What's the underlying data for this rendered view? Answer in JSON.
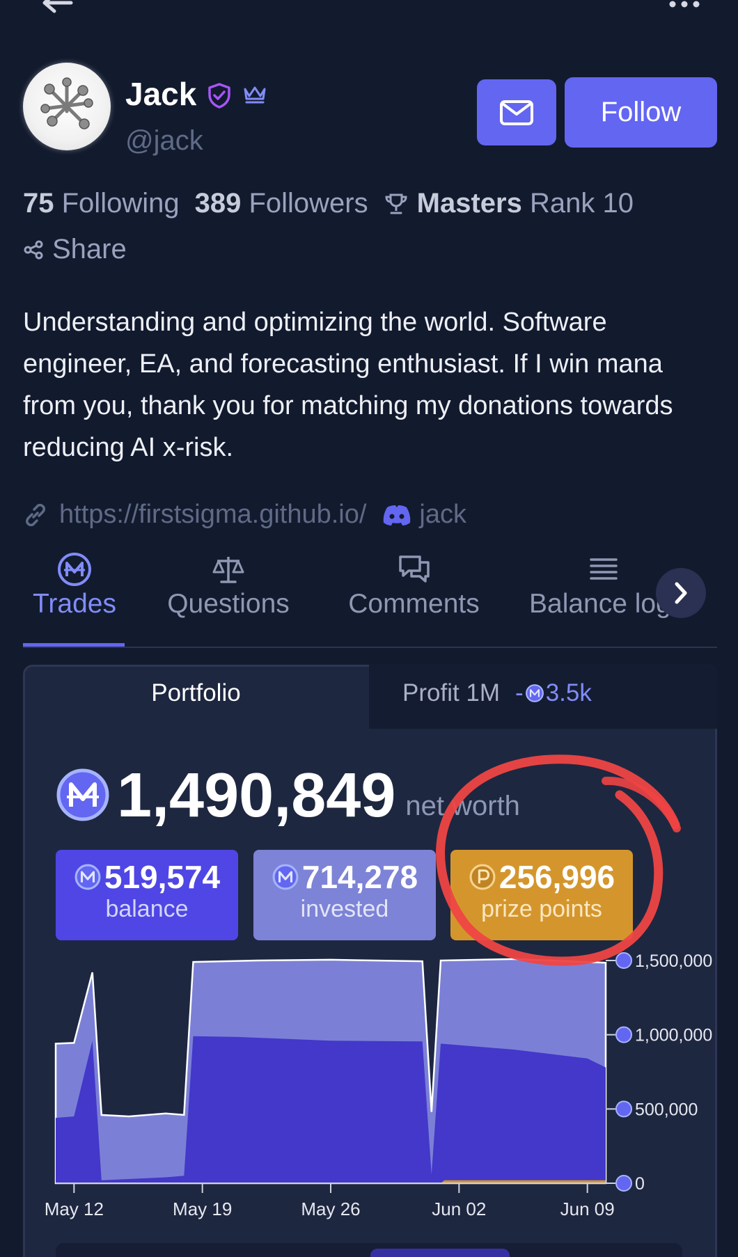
{
  "profile": {
    "name": "Jack",
    "handle": "@jack",
    "following_count": "75",
    "following_label": "Following",
    "followers_count": "389",
    "followers_label": "Followers",
    "league": "Masters",
    "rank": "Rank 10",
    "share_label": "Share",
    "bio": "Understanding and optimizing the world. Software engineer, EA, and forecasting enthusiast. If I win mana from you, thank you for matching my donations towards reducing AI x-risk.",
    "website": "https://firstsigma.github.io/",
    "discord": "jack",
    "follow_label": "Follow"
  },
  "tabs": [
    {
      "label": "Trades",
      "icon": "mana-icon",
      "active": true
    },
    {
      "label": "Questions",
      "icon": "scale-icon"
    },
    {
      "label": "Comments",
      "icon": "chat-icon"
    },
    {
      "label": "Balance log",
      "icon": "list-icon"
    }
  ],
  "portfolio": {
    "tab_portfolio": "Portfolio",
    "tab_profit": "Profit 1M",
    "profit_value": "3.5k",
    "profit_sign": "-",
    "net_worth": "1,490,849",
    "net_worth_label": "net worth",
    "balance": "519,574",
    "balance_label": "balance",
    "invested": "714,278",
    "invested_label": "invested",
    "prize_points": "256,996",
    "prize_points_label": "prize points"
  },
  "colors": {
    "accent": "#6366f1",
    "balance": "#4f46e5",
    "invested": "#7d83d6",
    "prize": "#d4962c",
    "annotation": "#ef4444"
  },
  "chart_data": {
    "type": "area",
    "x_labels": [
      "May 12",
      "May 19",
      "May 26",
      "Jun 02",
      "Jun 09"
    ],
    "y_ticks": [
      "0",
      "500,000",
      "1,000,000",
      "1,500,000"
    ],
    "ylim": [
      0,
      1500000
    ],
    "series": [
      {
        "name": "balance",
        "color": "#4338ca",
        "points": [
          [
            "May 11",
            440000
          ],
          [
            "May 12",
            450000
          ],
          [
            "May 13",
            960000
          ],
          [
            "May 13.5",
            20000
          ],
          [
            "May 17",
            40000
          ],
          [
            "May 18",
            50000
          ],
          [
            "May 18.5",
            990000
          ],
          [
            "May 21",
            985000
          ],
          [
            "May 26",
            960000
          ],
          [
            "May 31",
            955000
          ],
          [
            "May 31.5",
            60000
          ],
          [
            "Jun 01",
            940000
          ],
          [
            "Jun 05",
            900000
          ],
          [
            "Jun 09",
            840000
          ],
          [
            "Jun 10",
            780000
          ]
        ]
      },
      {
        "name": "net worth",
        "color": "#7b80d6",
        "points": [
          [
            "May 11",
            940000
          ],
          [
            "May 12",
            945000
          ],
          [
            "May 13",
            1420000
          ],
          [
            "May 13.5",
            460000
          ],
          [
            "May 15",
            450000
          ],
          [
            "May 17",
            470000
          ],
          [
            "May 18",
            460000
          ],
          [
            "May 18.5",
            1490000
          ],
          [
            "May 22",
            1500000
          ],
          [
            "May 26",
            1505000
          ],
          [
            "May 31",
            1495000
          ],
          [
            "May 31.5",
            480000
          ],
          [
            "Jun 01",
            1500000
          ],
          [
            "Jun 05",
            1510000
          ],
          [
            "Jun 09",
            1490000
          ],
          [
            "Jun 10",
            1485000
          ]
        ]
      },
      {
        "name": "prize points",
        "color": "#d4962c",
        "points": [
          [
            "Jun 01",
            0
          ],
          [
            "Jun 01.2",
            20000
          ],
          [
            "Jun 10",
            20000
          ]
        ]
      }
    ]
  }
}
